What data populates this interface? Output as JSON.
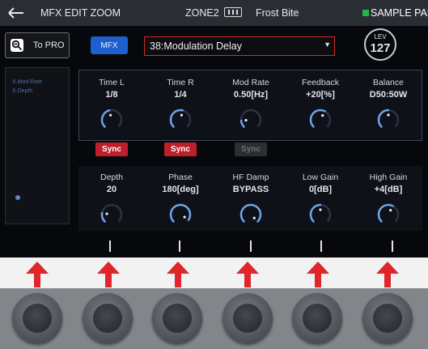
{
  "header": {
    "back_icon": "back-arrow-icon",
    "title": "MFX EDIT ZOOM",
    "zone": "ZONE2",
    "tone_name": "Frost Bite",
    "sample_pad": "SAMPLE PAD",
    "sample_pad_color": "#1fb84a"
  },
  "toolbar": {
    "to_pro_label": "To PRO",
    "mfx_label": "MFX",
    "mfx_type": "38:Modulation Delay",
    "lev_label": "LEV",
    "lev_value": "127"
  },
  "side_panel": {
    "lines": [
      "X.Mod Rate",
      "X.Depth"
    ]
  },
  "params_top": [
    {
      "name": "Time L",
      "value": "1/8",
      "knob": 0.45,
      "sync": "Sync",
      "sync_on": true
    },
    {
      "name": "Time R",
      "value": "1/4",
      "knob": 0.55,
      "sync": "Sync",
      "sync_on": true
    },
    {
      "name": "Mod Rate",
      "value": "0.50[Hz]",
      "knob": 0.15,
      "sync": "Sync",
      "sync_on": false
    },
    {
      "name": "Feedback",
      "value": "+20[%]",
      "knob": 0.6
    },
    {
      "name": "Balance",
      "value": "D50:50W",
      "knob": 0.5
    }
  ],
  "params_bottom": [
    {
      "name": "Depth",
      "value": "20",
      "knob": 0.2
    },
    {
      "name": "Phase",
      "value": "180[deg]",
      "knob": 0.95
    },
    {
      "name": "HF Damp",
      "value": "BYPASS",
      "knob": 1.0
    },
    {
      "name": "Low Gain",
      "value": "0[dB]",
      "knob": 0.5
    },
    {
      "name": "High Gain",
      "value": "+4[dB]",
      "knob": 0.6
    }
  ],
  "colors": {
    "accent": "#1c5fcf",
    "sync_on": "#bf1f2a",
    "arrow": "#e0262b",
    "select_border": "#d42a2a"
  }
}
